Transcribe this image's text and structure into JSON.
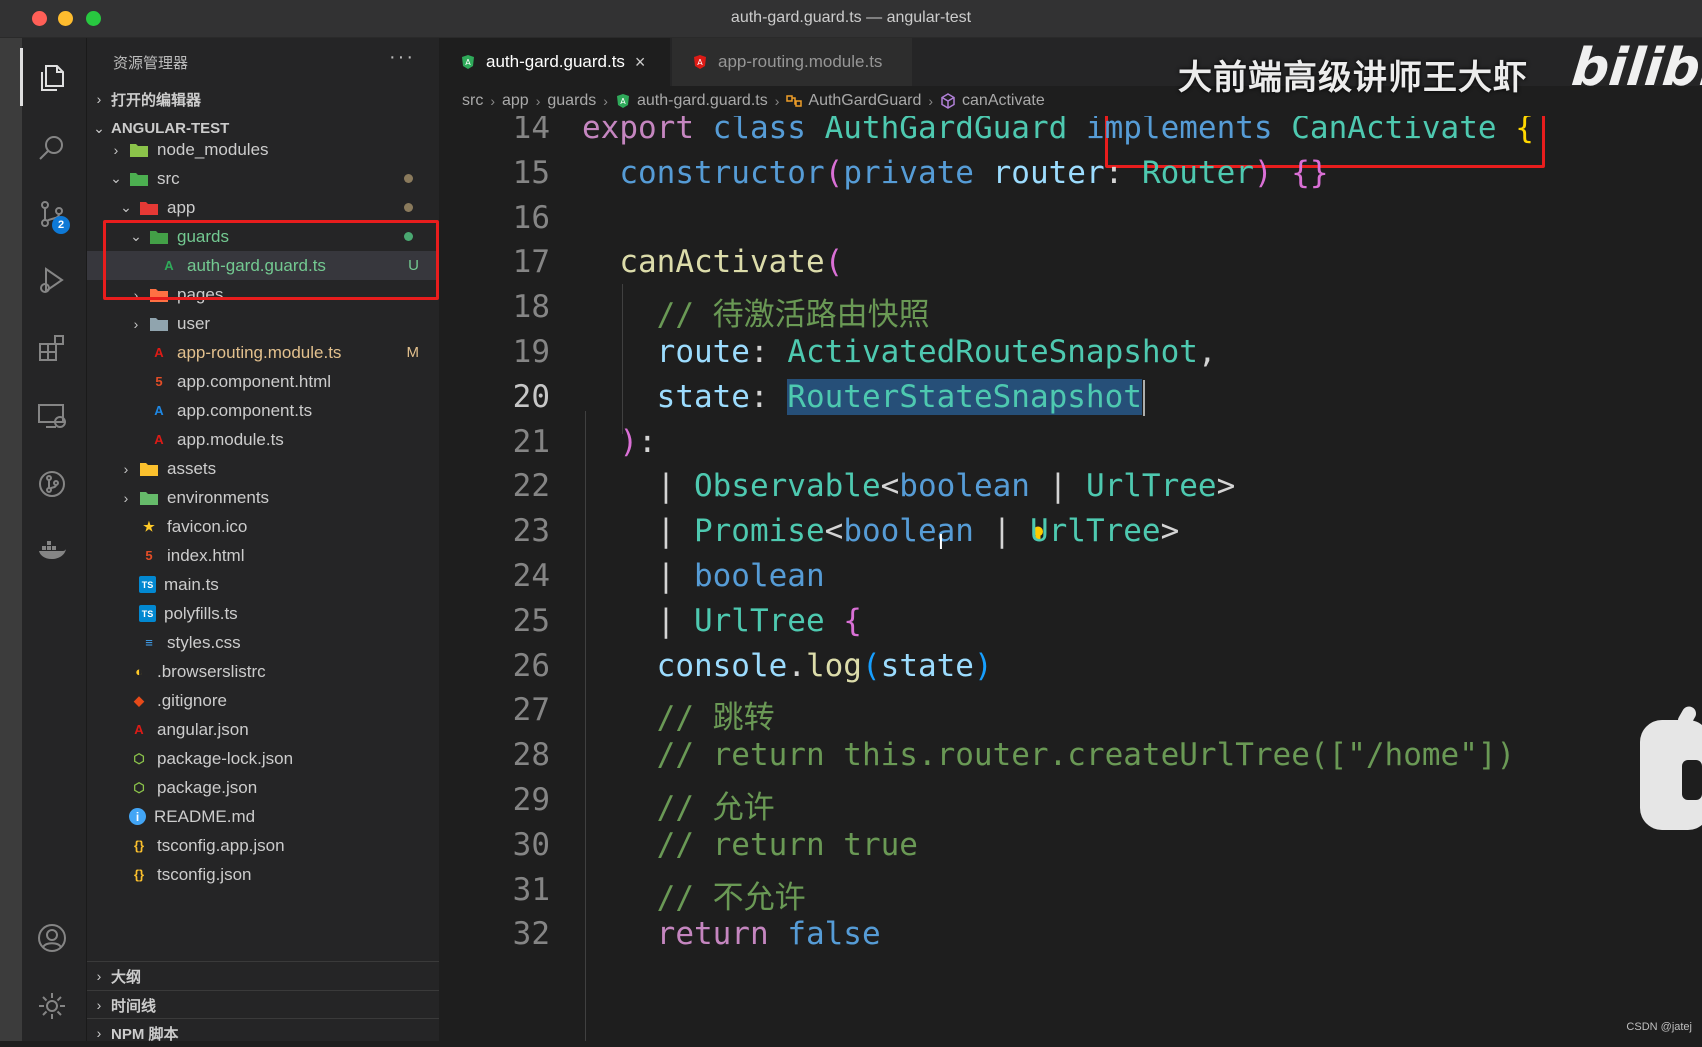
{
  "window": {
    "title": "auth-gard.guard.ts — angular-test"
  },
  "activity_bar": {
    "source_control_badge": "2"
  },
  "sidebar": {
    "header": "资源管理器",
    "more": "···",
    "open_editors": "打开的编辑器",
    "project": "ANGULAR-TEST",
    "tree": [
      {
        "label": "node_modules",
        "icon": "folder-node-icon",
        "depth": 1,
        "chev": "›"
      },
      {
        "label": "src",
        "icon": "folder-src-icon",
        "depth": 1,
        "chev": "⌄"
      },
      {
        "label": "app",
        "icon": "folder-app-icon",
        "depth": 2,
        "chev": "⌄"
      },
      {
        "label": "guards",
        "icon": "folder-guard-icon",
        "depth": 3,
        "chev": "⌄"
      },
      {
        "label": "auth-gard.guard.ts",
        "icon": "angular-guard-icon",
        "depth": 4,
        "status": "U"
      },
      {
        "label": "pages",
        "icon": "folder-views-icon",
        "depth": 3,
        "chev": "›"
      },
      {
        "label": "user",
        "icon": "folder-icon",
        "depth": 3,
        "chev": "›"
      },
      {
        "label": "app-routing.module.ts",
        "icon": "angular-icon",
        "depth": 3,
        "status": "M"
      },
      {
        "label": "app.component.html",
        "icon": "html-icon",
        "depth": 3
      },
      {
        "label": "app.component.ts",
        "icon": "angular-component-icon",
        "depth": 3
      },
      {
        "label": "app.module.ts",
        "icon": "angular-icon",
        "depth": 3
      },
      {
        "label": "assets",
        "icon": "folder-assets-icon",
        "depth": 2,
        "chev": "›"
      },
      {
        "label": "environments",
        "icon": "folder-env-icon",
        "depth": 2,
        "chev": "›"
      },
      {
        "label": "favicon.ico",
        "icon": "star-icon",
        "depth": 2
      },
      {
        "label": "index.html",
        "icon": "html-icon",
        "depth": 2
      },
      {
        "label": "main.ts",
        "icon": "typescript-icon",
        "depth": 2
      },
      {
        "label": "polyfills.ts",
        "icon": "typescript-icon",
        "depth": 2
      },
      {
        "label": "styles.css",
        "icon": "css-icon",
        "depth": 2
      },
      {
        "label": ".browserslistrc",
        "icon": "browserslist-icon",
        "depth": 1
      },
      {
        "label": ".gitignore",
        "icon": "git-icon",
        "depth": 1
      },
      {
        "label": "angular.json",
        "icon": "angular-icon",
        "depth": 1
      },
      {
        "label": "package-lock.json",
        "icon": "nodejs-icon",
        "depth": 1
      },
      {
        "label": "package.json",
        "icon": "nodejs-icon",
        "depth": 1
      },
      {
        "label": "README.md",
        "icon": "info-icon",
        "depth": 1
      },
      {
        "label": "tsconfig.app.json",
        "icon": "json-icon",
        "depth": 1
      },
      {
        "label": "tsconfig.json",
        "icon": "json-icon",
        "depth": 1
      }
    ],
    "bottom_sections": [
      "大纲",
      "时间线",
      "NPM 脚本"
    ]
  },
  "tabs": [
    {
      "label": "auth-gard.guard.ts",
      "active": true,
      "close": "×"
    },
    {
      "label": "app-routing.module.ts",
      "active": false
    }
  ],
  "breadcrumb": [
    "src",
    "app",
    "guards",
    "auth-gard.guard.ts",
    "AuthGardGuard",
    "canActivate"
  ],
  "watermark": "大前端高级讲师王大虾",
  "bili_logo": "bilibili",
  "code": {
    "line_numbers": [
      "14",
      "15",
      "16",
      "17",
      "18",
      "19",
      "20",
      "21",
      "22",
      "23",
      "24",
      "25",
      "26",
      "27",
      "28",
      "29",
      "30",
      "31",
      "32"
    ],
    "current_line": "20",
    "lines": [
      [
        [
          "export ",
          "kw"
        ],
        [
          "class ",
          "kb"
        ],
        [
          "AuthGardGuard ",
          "ty"
        ],
        [
          "implements ",
          "kb"
        ],
        [
          "CanActivate ",
          "ty"
        ],
        [
          "{",
          "br1"
        ]
      ],
      [
        [
          "  ",
          ""
        ],
        [
          "constructor",
          "kb"
        ],
        [
          "(",
          "br2"
        ],
        [
          "private ",
          "kb"
        ],
        [
          "router",
          "vr"
        ],
        [
          ": ",
          ""
        ],
        [
          "Router",
          "ty"
        ],
        [
          ") ",
          "br2"
        ],
        [
          "{}",
          "br2"
        ]
      ],
      [],
      [
        [
          "  ",
          ""
        ],
        [
          "canActivate",
          "fn"
        ],
        [
          "(",
          "br2"
        ]
      ],
      [
        [
          "    ",
          ""
        ],
        [
          "// 待激活路由快照",
          "cm"
        ]
      ],
      [
        [
          "    ",
          ""
        ],
        [
          "route",
          "vr"
        ],
        [
          ": ",
          ""
        ],
        [
          "ActivatedRouteSnapshot",
          "ty"
        ],
        [
          ",",
          ""
        ]
      ],
      [
        [
          "    ",
          ""
        ],
        [
          "state",
          "vr"
        ],
        [
          ": ",
          ""
        ],
        [
          "RouterStateSnapshot",
          "ty sel"
        ]
      ],
      [
        [
          "  ",
          ""
        ],
        [
          ")",
          "br2"
        ],
        [
          ":",
          ""
        ]
      ],
      [
        [
          "    ",
          ""
        ],
        [
          "| ",
          ""
        ],
        [
          "Observable",
          "ty"
        ],
        [
          "<",
          ""
        ],
        [
          "boolean ",
          "kb"
        ],
        [
          "| ",
          ""
        ],
        [
          "UrlTree",
          "ty"
        ],
        [
          ">",
          ""
        ]
      ],
      [
        [
          "    ",
          ""
        ],
        [
          "| ",
          ""
        ],
        [
          "Promise",
          "ty"
        ],
        [
          "<",
          ""
        ],
        [
          "boolean ",
          "kb"
        ],
        [
          "| ",
          ""
        ],
        [
          "UrlTree",
          "ty"
        ],
        [
          ">",
          ""
        ]
      ],
      [
        [
          "    ",
          ""
        ],
        [
          "| ",
          ""
        ],
        [
          "boolean",
          "kb"
        ]
      ],
      [
        [
          "    ",
          ""
        ],
        [
          "| ",
          ""
        ],
        [
          "UrlTree ",
          "ty"
        ],
        [
          "{",
          "br2"
        ]
      ],
      [
        [
          "    ",
          ""
        ],
        [
          "console",
          "vr"
        ],
        [
          ".",
          ""
        ],
        [
          "log",
          "fn"
        ],
        [
          "(",
          "br3"
        ],
        [
          "state",
          "vr"
        ],
        [
          ")",
          "br3"
        ]
      ],
      [
        [
          "    ",
          ""
        ],
        [
          "// 跳转",
          "cm"
        ]
      ],
      [
        [
          "    ",
          ""
        ],
        [
          "// return this.router.createUrlTree([\"/home\"])",
          "cm"
        ]
      ],
      [
        [
          "    ",
          ""
        ],
        [
          "// 允许",
          "cm"
        ]
      ],
      [
        [
          "    ",
          ""
        ],
        [
          "// return true",
          "cm"
        ]
      ],
      [
        [
          "    ",
          ""
        ],
        [
          "// 不允许",
          "cm"
        ]
      ],
      [
        [
          "    ",
          ""
        ],
        [
          "return ",
          "kw"
        ],
        [
          "false",
          "kb"
        ]
      ]
    ]
  },
  "credit": "CSDN @jatej",
  "colors": {
    "accent": "#0e79d6",
    "highlight_box": "#e81d1d",
    "editor_bg": "#1e1e1e",
    "sidebar_bg": "#252526"
  }
}
